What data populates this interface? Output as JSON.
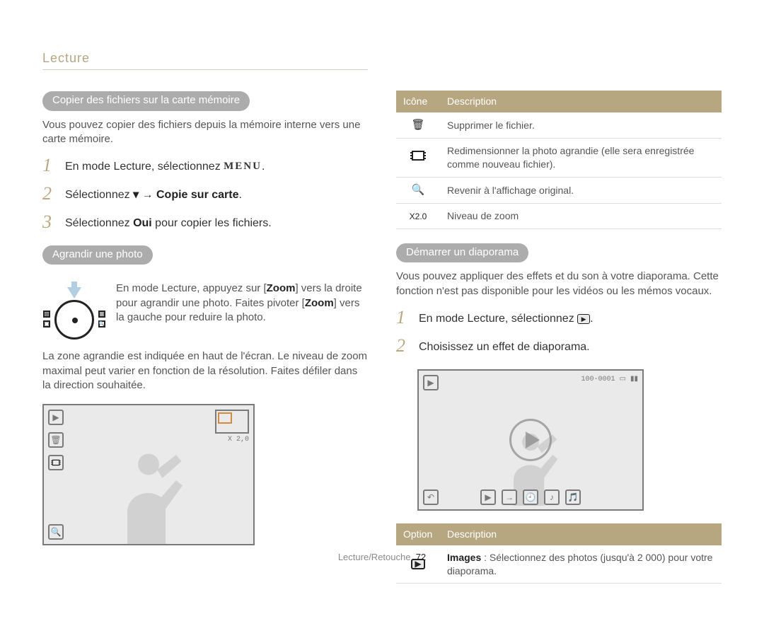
{
  "header": {
    "section": "Lecture"
  },
  "left": {
    "heading1": "Copier des fichiers sur la carte mémoire",
    "intro1": "Vous pouvez copier des fichiers depuis la mémoire interne vers une carte mémoire.",
    "steps1": [
      {
        "pre": "En mode Lecture, sélectionnez ",
        "menu": "MENU",
        "post": "."
      },
      {
        "pre": "Sélectionnez ",
        "icon": "▾",
        "arrow": " → ",
        "bold": "Copie sur carte",
        "post": "."
      },
      {
        "pre": "Sélectionnez ",
        "bold": "Oui",
        "post": " pour copier les fichiers."
      }
    ],
    "heading2": "Agrandir une photo",
    "zoom_text_a": "En mode Lecture, appuyez sur [",
    "zoom_bold_a": "Zoom",
    "zoom_text_b": "] vers la droite pour agrandir une photo. Faites pivoter [",
    "zoom_bold_b": "Zoom",
    "zoom_text_c": "] vers la gauche pour reduire la photo.",
    "para2": "La zone agrandie est indiquée en haut de l'écran. Le niveau de zoom maximal peut varier en fonction de la résolution. Faites défiler dans la direction souhaitée.",
    "zoom_label": "X 2,0"
  },
  "right": {
    "table1": {
      "col1": "Icône",
      "col2": "Description",
      "rows": [
        {
          "icon": "🗑",
          "desc": "Supprimer le fichier."
        },
        {
          "icon": "film",
          "desc": "Redimensionner la photo agrandie (elle sera enregistrée comme nouveau fichier)."
        },
        {
          "icon": "🔍",
          "desc": "Revenir à l'affichage original."
        },
        {
          "icon": "X2.0",
          "desc": "Niveau de zoom"
        }
      ]
    },
    "heading3": "Démarrer un diaporama",
    "intro3": "Vous pouvez appliquer des effets et du son à votre diaporama. Cette fonction n'est pas disponible pour les vidéos ou les mémos vocaux.",
    "steps3": [
      {
        "pre": "En mode Lecture, sélectionnez ",
        "icon": "▶",
        "post": "."
      },
      {
        "pre": "Choisissez un effet de diaporama."
      }
    ],
    "screen_top_info": "100-0001",
    "table2": {
      "col1": "Option",
      "col2": "Description",
      "row_icon": "▶",
      "row_label": "Images",
      "row_desc": " : Sélectionnez des photos (jusqu'à 2 000) pour votre diaporama."
    }
  },
  "footer": {
    "text": "Lecture/Retouche",
    "page": "72"
  }
}
